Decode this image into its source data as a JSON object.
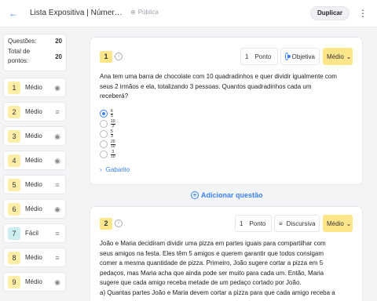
{
  "header": {
    "back_icon": "arrow-left-icon",
    "title": "Lista Expositiva | Números ...",
    "visibility": "Pública",
    "duplicate_label": "Duplicar"
  },
  "summary": {
    "questions_label": "Questões:",
    "questions_value": "20",
    "points_label": "Total de pontos:",
    "points_value": "20"
  },
  "sidebar": {
    "items": [
      {
        "num": "1",
        "difficulty": "Médio",
        "type": "objetiva"
      },
      {
        "num": "2",
        "difficulty": "Médio",
        "type": "discursiva"
      },
      {
        "num": "3",
        "difficulty": "Médio",
        "type": "objetiva"
      },
      {
        "num": "4",
        "difficulty": "Médio",
        "type": "objetiva"
      },
      {
        "num": "5",
        "difficulty": "Médio",
        "type": "discursiva"
      },
      {
        "num": "6",
        "difficulty": "Médio",
        "type": "objetiva"
      },
      {
        "num": "7",
        "difficulty": "Fácil",
        "type": "discursiva"
      },
      {
        "num": "8",
        "difficulty": "Médio",
        "type": "discursiva"
      },
      {
        "num": "9",
        "difficulty": "Médio",
        "type": "objetiva"
      }
    ]
  },
  "q1": {
    "num": "1",
    "points_value": "1",
    "points_label": "Ponto",
    "type_label": "Objetiva",
    "difficulty": "Médio",
    "text_lines": [
      "Ana tem uma barra de chocolate com 10 quadradinhos e quer dividir igualmente com",
      "seus 2 irmãos e ela, totalizando 3 pessoas. Quantos quadradinhos cada um",
      "receberá?"
    ],
    "options": [
      {
        "num": "6",
        "den": "5",
        "selected": true
      },
      {
        "num": "10",
        "den": "3",
        "selected": false
      },
      {
        "num": "5",
        "den": "3",
        "selected": false
      },
      {
        "num": "20",
        "den": "10",
        "selected": false
      },
      {
        "num": "3",
        "den": "10",
        "selected": false
      }
    ],
    "gabarito_label": "Gabarito"
  },
  "add_question_label": "Adicionar questão",
  "q2": {
    "num": "2",
    "points_value": "1",
    "points_label": "Ponto",
    "type_label": "Discursiva",
    "difficulty": "Médio",
    "text_lines": [
      "João e Maria decidiram dividir uma pizza em partes iguais para compartilhar com",
      "seus amigos na festa. Eles têm 5 amigos e querem garantir que todos consigam",
      "comer a mesma quantidade de pizza. Primeiro, João sugere cortar a pizza em 5",
      "pedaços, mas Maria acha que ainda pode ser muito para cada um. Então, Maria",
      "sugere que cada amigo receba metade de um pedaço cortado por João.",
      "a) Quantas partes João e Maria devem cortar a pizza para que cada amigo receba a"
    ]
  },
  "colors": {
    "accent": "#3b82f6",
    "difficulty_medium": "#fde68a",
    "difficulty_easy": "#cdeef0"
  }
}
